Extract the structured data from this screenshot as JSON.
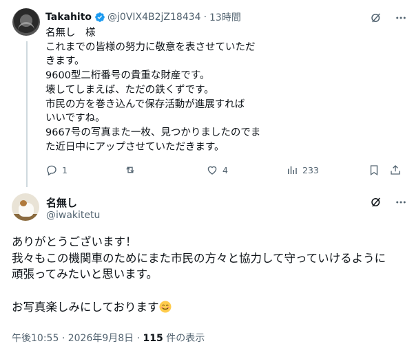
{
  "reply": {
    "author_name": "Takahito",
    "handle": "@j0VIX4B2jZ18434",
    "separator": "·",
    "time": "13時間",
    "body_lines": [
      "名無し　様",
      "これまでの皆様の努力に敬意を表させていただ",
      "きます。",
      "9600型二桁番号の貴重な財産です。",
      "壊してしまえば、ただの鉄くずです。",
      "市民の方を巻き込んで保存活動が進展すれば",
      "いいですね。",
      "9667号の写真また一枚、見つかりましたのでま",
      "た近日中にアップさせていただきます。"
    ],
    "actions": {
      "replies": "1",
      "reposts": "",
      "likes": "4",
      "views": "233"
    }
  },
  "main": {
    "author_name": "名無し",
    "handle": "@iwakitetu",
    "body_lines": [
      "ありがとうございます！",
      "我々もこの機関車のためにまた市民の方々と協力して守っていけるように",
      "頑張ってみたいと思います。",
      "",
      "お写真楽しみにしております"
    ],
    "footer": {
      "time": "午後10:55",
      "separator1": "·",
      "date": "2026年9月8日",
      "separator2": "·",
      "view_count": "115",
      "view_label": "件の表示"
    }
  },
  "icons": {
    "reply_grok": "grok-icon",
    "reply_more": "more-icon",
    "reply_action": "comment-icon",
    "repost": "repost-icon",
    "like": "heart-icon",
    "views": "chart-icon",
    "bookmark": "bookmark-icon",
    "share": "share-icon",
    "emoji": "smiling-face-icon"
  },
  "colors": {
    "text": "#0f1419",
    "muted": "#536471",
    "verified": "#1d9bf0",
    "thread_line": "#cfd9de"
  }
}
